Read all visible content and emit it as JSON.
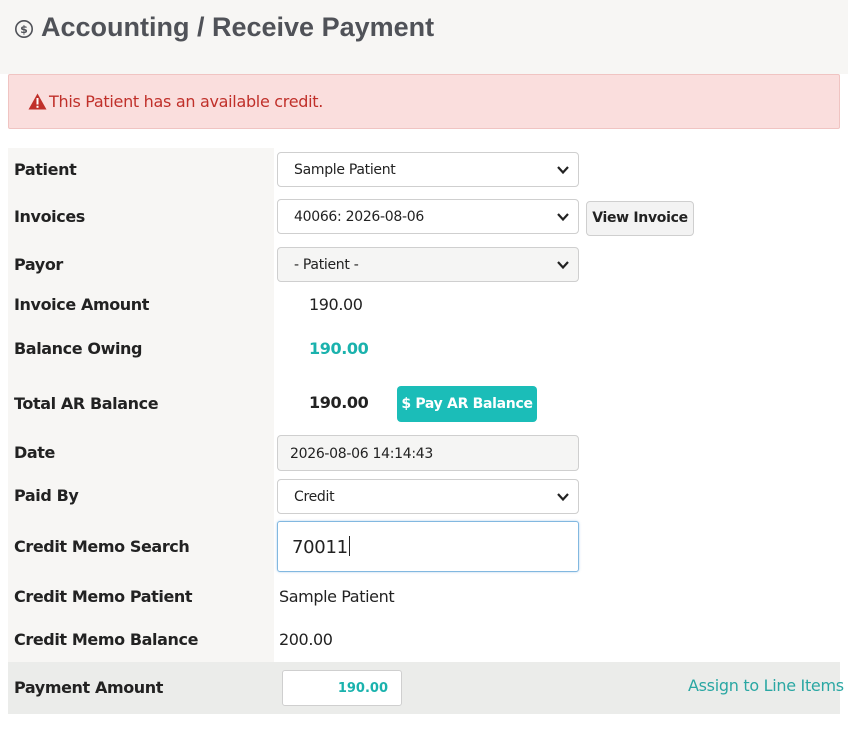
{
  "header": {
    "title": "Accounting / Receive Payment",
    "icon": "dollar-circle-icon"
  },
  "alert": {
    "icon": "warning-triangle-icon",
    "message": "This Patient has an available credit.",
    "color": "#c0302a"
  },
  "form": {
    "patient": {
      "label": "Patient",
      "value": "Sample Patient"
    },
    "invoices": {
      "label": "Invoices",
      "value": "40066: 2026-08-06",
      "view_button": "View Invoice"
    },
    "payor": {
      "label": "Payor",
      "value": "- Patient -"
    },
    "invoice_amount": {
      "label": "Invoice Amount",
      "value": "190.00"
    },
    "balance_owing": {
      "label": "Balance Owing",
      "value": "190.00"
    },
    "total_ar_balance": {
      "label": "Total AR Balance",
      "value": "190.00",
      "pay_button": "$ Pay AR Balance"
    },
    "date": {
      "label": "Date",
      "value": "2026-08-06 14:14:43"
    },
    "paid_by": {
      "label": "Paid By",
      "value": "Credit"
    },
    "credit_memo_search": {
      "label": "Credit Memo Search",
      "value": "70011"
    },
    "credit_memo_patient": {
      "label": "Credit Memo Patient",
      "value": "Sample Patient"
    },
    "credit_memo_balance": {
      "label": "Credit Memo Balance",
      "value": "200.00"
    },
    "payment_amount": {
      "label": "Payment Amount",
      "value": "190.00",
      "assign_link": "Assign to Line Items"
    }
  },
  "colors": {
    "accent": "#1bbdb8",
    "alert_bg": "#fadedd",
    "label_bg": "#f7f6f4"
  }
}
